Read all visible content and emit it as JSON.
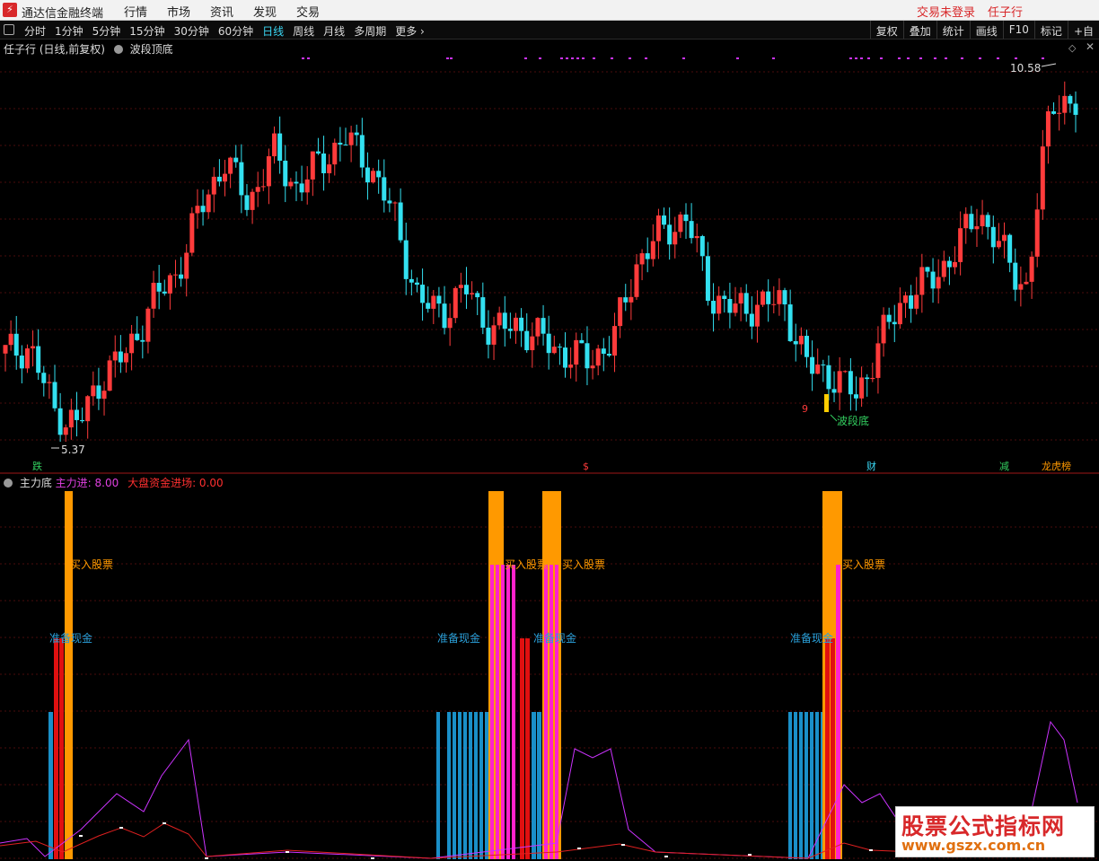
{
  "app": {
    "title": "通达信金融终端",
    "menu": [
      "行情",
      "市场",
      "资讯",
      "发现",
      "交易"
    ],
    "login_status": "交易未登录",
    "user": "任子行"
  },
  "toolbar": {
    "periods": [
      "分时",
      "1分钟",
      "5分钟",
      "15分钟",
      "30分钟",
      "60分钟",
      "日线",
      "周线",
      "月线",
      "多周期",
      "更多 ›"
    ],
    "active_period": "日线",
    "right_tools": [
      "复权",
      "叠加",
      "统计",
      "画线",
      "F10",
      "标记",
      "+自"
    ]
  },
  "kline": {
    "header_title": "任子行 (日线,前复权)",
    "indicator_name": "波段顶底",
    "max_label": "10.58",
    "min_label": "5.37",
    "bottom_signal": "波段底",
    "bottom_signal_number": "9",
    "event_markers": [
      "跌",
      "$",
      "财",
      "减",
      "龙虎榜"
    ],
    "colors": {
      "up": "#ff3b3b",
      "down": "#33e0f0",
      "signal": "#ffcc00",
      "marker": "#cc33ff"
    }
  },
  "indicator": {
    "name": "主力底",
    "line1_label": "主力进: 8.00",
    "line2_label": "大盘资金进场: 0.00",
    "texts": [
      "买入股票",
      "准备现金"
    ],
    "colors": {
      "blue": "#1a8fc8",
      "red": "#e01010",
      "orange": "#ff9900",
      "magenta": "#ff22cc",
      "line_purple": "#cc33ff",
      "line_red": "#e02020"
    }
  },
  "chart_data": [
    {
      "type": "candlestick",
      "title": "任子行 (日线,前复权)",
      "min": 5.37,
      "max": 10.58,
      "approx_close_path": [
        6.6,
        6.7,
        5.8,
        5.6,
        6.3,
        6.6,
        7.3,
        7.7,
        8.6,
        9.3,
        8.7,
        9.4,
        8.9,
        9.3,
        9.6,
        9.2,
        8.5,
        7.3,
        7.2,
        7.5,
        6.9,
        7.0,
        6.8,
        6.6,
        6.5,
        6.8,
        7.9,
        8.3,
        8.5,
        7.4,
        7.2,
        7.3,
        7.3,
        6.4,
        6.3,
        6.0,
        6.8,
        7.4,
        7.6,
        8.0,
        8.6,
        8.0,
        7.5,
        10.2,
        10.0
      ]
    },
    {
      "type": "bar",
      "title": "主力底",
      "series": [
        {
          "name": "主力进",
          "last_value": 8.0
        },
        {
          "name": "大盘资金进场",
          "last_value": 0.0
        }
      ]
    }
  ]
}
